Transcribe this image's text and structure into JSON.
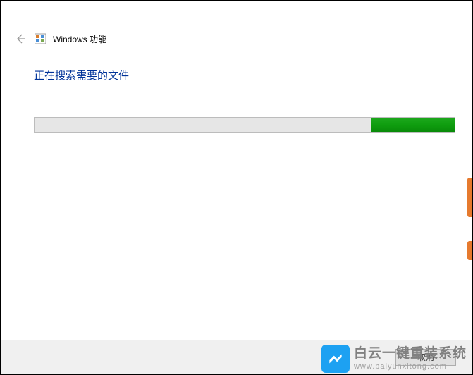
{
  "header": {
    "title": "Windows 功能"
  },
  "status": {
    "message": "正在搜索需要的文件"
  },
  "progress": {
    "percent": 20,
    "indeterminate_style": "right-fill"
  },
  "footer": {
    "cancel_label": "取消"
  },
  "watermark": {
    "main": "白云一键重装系统",
    "url": "www.baiyunxitong.com"
  }
}
